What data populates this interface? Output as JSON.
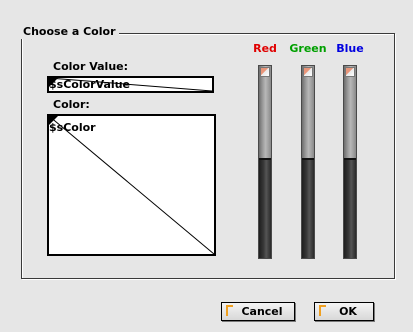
{
  "dialog": {
    "group_title": "Choose a Color"
  },
  "color_value": {
    "label": "Color Value:",
    "field_text": "$sColorValue"
  },
  "color": {
    "label": "Color:",
    "field_text": "$sColor"
  },
  "sliders": {
    "red": {
      "label": "Red",
      "color": "#e00000",
      "level": 0.52
    },
    "green": {
      "label": "Green",
      "color": "#00a000",
      "level": 0.52
    },
    "blue": {
      "label": "Blue",
      "color": "#0000e0",
      "level": 0.52
    }
  },
  "buttons": {
    "cancel_label": "Cancel",
    "ok_label": "OK"
  }
}
